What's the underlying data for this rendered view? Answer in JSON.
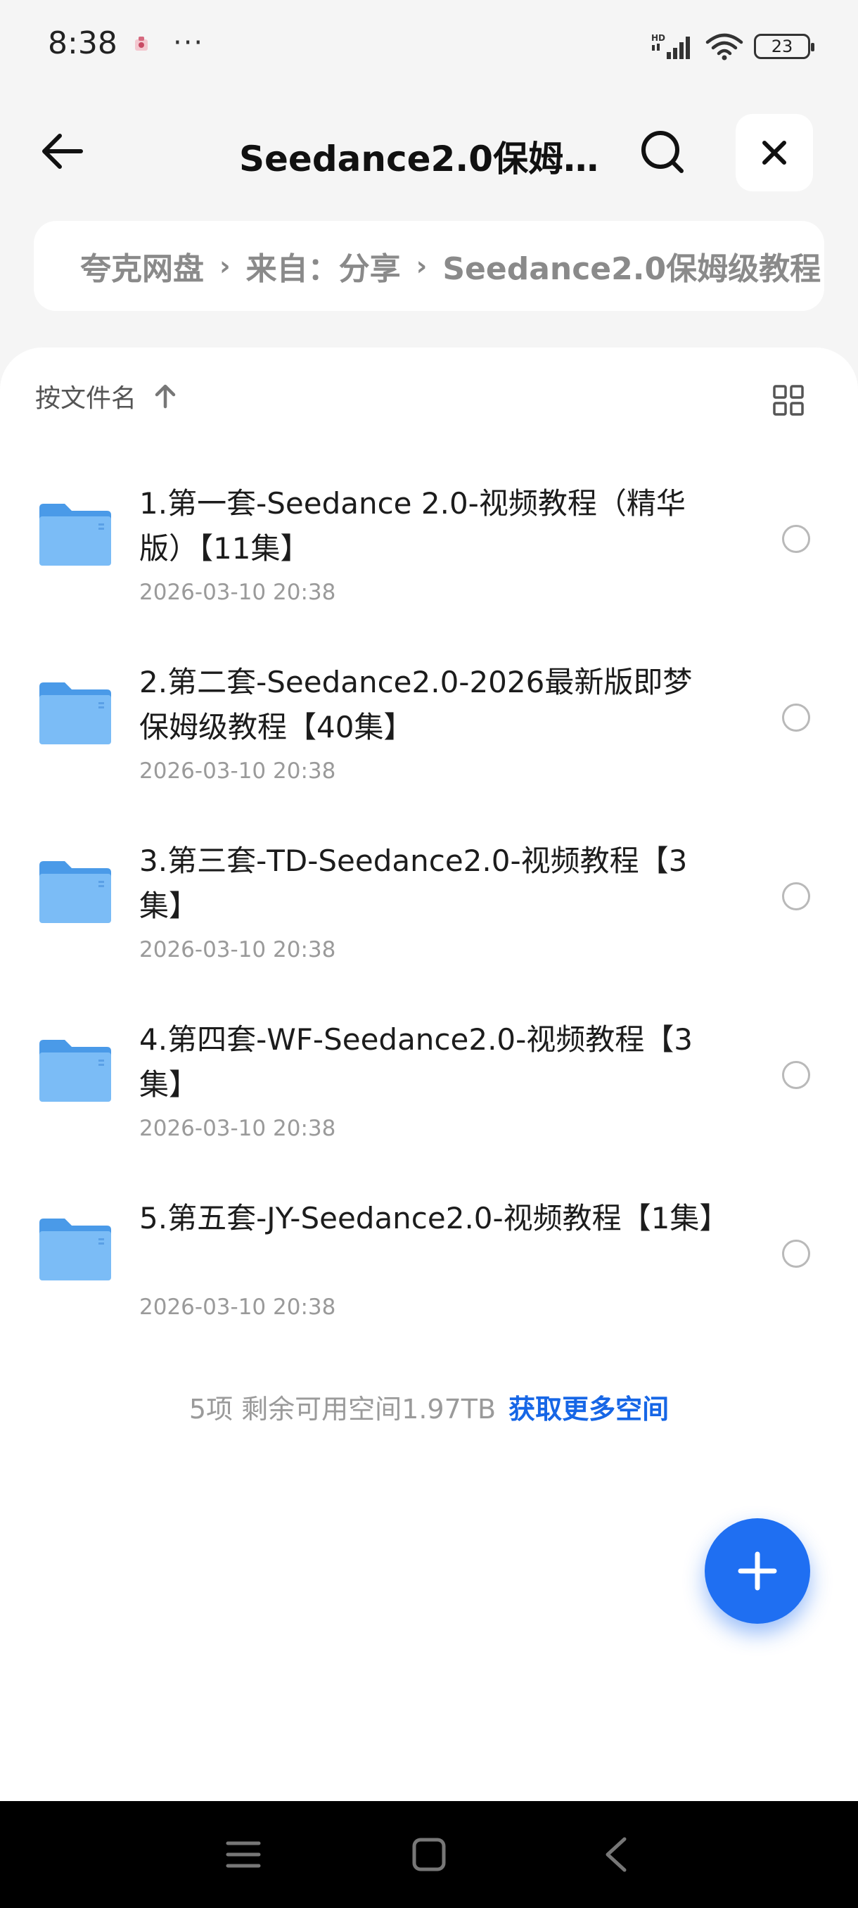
{
  "status_bar": {
    "time": "8:38",
    "more": "···",
    "battery": "23",
    "icons": [
      "hd-signal-icon",
      "wifi-icon",
      "battery-icon"
    ]
  },
  "header": {
    "title": "Seedance2.0保姆级...",
    "icons": [
      "back-arrow-icon",
      "search-icon",
      "close-icon"
    ]
  },
  "breadcrumb": {
    "items": [
      "夸克网盘",
      "来自：分享",
      "Seedance2.0保姆级教程"
    ]
  },
  "sort": {
    "label": "按文件名"
  },
  "files": [
    {
      "name": "1.第一套-Seedance 2.0-视频教程（精华版）【11集】",
      "date": "2026-03-10 20:38"
    },
    {
      "name": "2.第二套-Seedance2.0-2026最新版即梦保姆级教程【40集】",
      "date": "2026-03-10 20:38"
    },
    {
      "name": "3.第三套-TD-Seedance2.0-视频教程【3集】",
      "date": "2026-03-10 20:38"
    },
    {
      "name": "4.第四套-WF-Seedance2.0-视频教程【3集】",
      "date": "2026-03-10 20:38"
    },
    {
      "name": "5.第五套-JY-Seedance2.0-视频教程【1集】",
      "date": "2026-03-10 20:38"
    }
  ],
  "footer": {
    "summary": "5项 剩余可用空间1.97TB",
    "more_space": "获取更多空间"
  },
  "colors": {
    "accent": "#1f6ff2",
    "link": "#1666e6",
    "folder": "#5aa9f5"
  }
}
